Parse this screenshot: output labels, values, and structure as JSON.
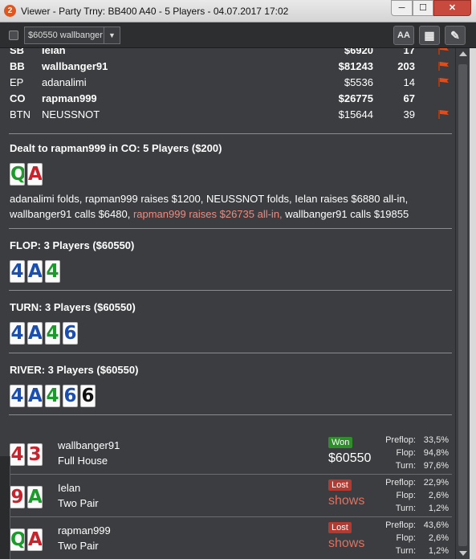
{
  "window": {
    "app_icon_text": "2",
    "title": "Viewer - Party Trny: BB400 A40 - 5 Players - 04.07.2017 17:02",
    "minimize_glyph": "─",
    "maximize_glyph": "☐",
    "close_glyph": "✕"
  },
  "toolbar": {
    "selected_value": "$60550 wallbanger",
    "dropdown_glyph": "▼",
    "font_button_label": "AA",
    "grid_button_glyph": "▦",
    "edit_button_glyph": "✎"
  },
  "players": [
    {
      "pos": "SB",
      "name": "Ielan",
      "stack": "$6920",
      "hands": "17",
      "bold": true,
      "flag": true
    },
    {
      "pos": "BB",
      "name": "wallbanger91",
      "stack": "$81243",
      "hands": "203",
      "bold": true,
      "flag": true
    },
    {
      "pos": "EP",
      "name": "adanalimi",
      "stack": "$5536",
      "hands": "14",
      "bold": false,
      "flag": true
    },
    {
      "pos": "CO",
      "name": "rapman999",
      "stack": "$26775",
      "hands": "67",
      "bold": true,
      "flag": false
    },
    {
      "pos": "BTN",
      "name": "NEUSSNOT",
      "stack": "$15644",
      "hands": "39",
      "bold": false,
      "flag": true
    }
  ],
  "preflop": {
    "heading": "Dealt to rapman999 in CO: 5 Players ($200)",
    "hole_cards": [
      {
        "rank": "Q",
        "color": "green"
      },
      {
        "rank": "A",
        "color": "red"
      }
    ],
    "action_text": "adanalimi folds, rapman999 raises $1200, NEUSSNOT folds, Ielan raises $6880 all-in, wallbanger91 calls $6480, ",
    "action_highlight": "rapman999 raises $26735 all-in,",
    "action_tail": " wallbanger91 calls $19855"
  },
  "flop": {
    "heading": "FLOP: 3 Players ($60550)",
    "cards": [
      {
        "rank": "4",
        "color": "blue"
      },
      {
        "rank": "A",
        "color": "blue"
      },
      {
        "rank": "4",
        "color": "green"
      }
    ]
  },
  "turn": {
    "heading": "TURN: 3 Players ($60550)",
    "cards": [
      {
        "rank": "4",
        "color": "blue"
      },
      {
        "rank": "A",
        "color": "blue"
      },
      {
        "rank": "4",
        "color": "green"
      },
      {
        "rank": "6",
        "color": "blue"
      }
    ]
  },
  "river": {
    "heading": "RIVER: 3 Players ($60550)",
    "cards": [
      {
        "rank": "4",
        "color": "blue"
      },
      {
        "rank": "A",
        "color": "blue"
      },
      {
        "rank": "4",
        "color": "green"
      },
      {
        "rank": "6",
        "color": "blue"
      },
      {
        "rank": "6",
        "color": "black"
      }
    ]
  },
  "showdown": [
    {
      "name": "wallbanger91",
      "hand": "Full House",
      "cards": [
        {
          "rank": "4",
          "color": "red"
        },
        {
          "rank": "3",
          "color": "red"
        }
      ],
      "result": "Won",
      "amount": "$60550",
      "equity": [
        {
          "label": "Preflop:",
          "value": "33,5%"
        },
        {
          "label": "Flop:",
          "value": "94,8%"
        },
        {
          "label": "Turn:",
          "value": "97,6%"
        }
      ]
    },
    {
      "name": "Ielan",
      "hand": "Two Pair",
      "cards": [
        {
          "rank": "9",
          "color": "red"
        },
        {
          "rank": "A",
          "color": "green"
        }
      ],
      "result": "Lost",
      "amount": "shows",
      "equity": [
        {
          "label": "Preflop:",
          "value": "22,9%"
        },
        {
          "label": "Flop:",
          "value": "2,6%"
        },
        {
          "label": "Turn:",
          "value": "1,2%"
        }
      ]
    },
    {
      "name": "rapman999",
      "hand": "Two Pair",
      "cards": [
        {
          "rank": "Q",
          "color": "green"
        },
        {
          "rank": "A",
          "color": "red"
        }
      ],
      "result": "Lost",
      "amount": "shows",
      "equity": [
        {
          "label": "Preflop:",
          "value": "43,6%"
        },
        {
          "label": "Flop:",
          "value": "2,6%"
        },
        {
          "label": "Turn:",
          "value": "1,2%"
        }
      ]
    }
  ],
  "colors": {
    "background": "#3b3d40",
    "highlight_text": "#f08a80",
    "won_badge": "#2f8d2b",
    "lost_badge": "#b23a30",
    "flag": "#e34c1a"
  }
}
